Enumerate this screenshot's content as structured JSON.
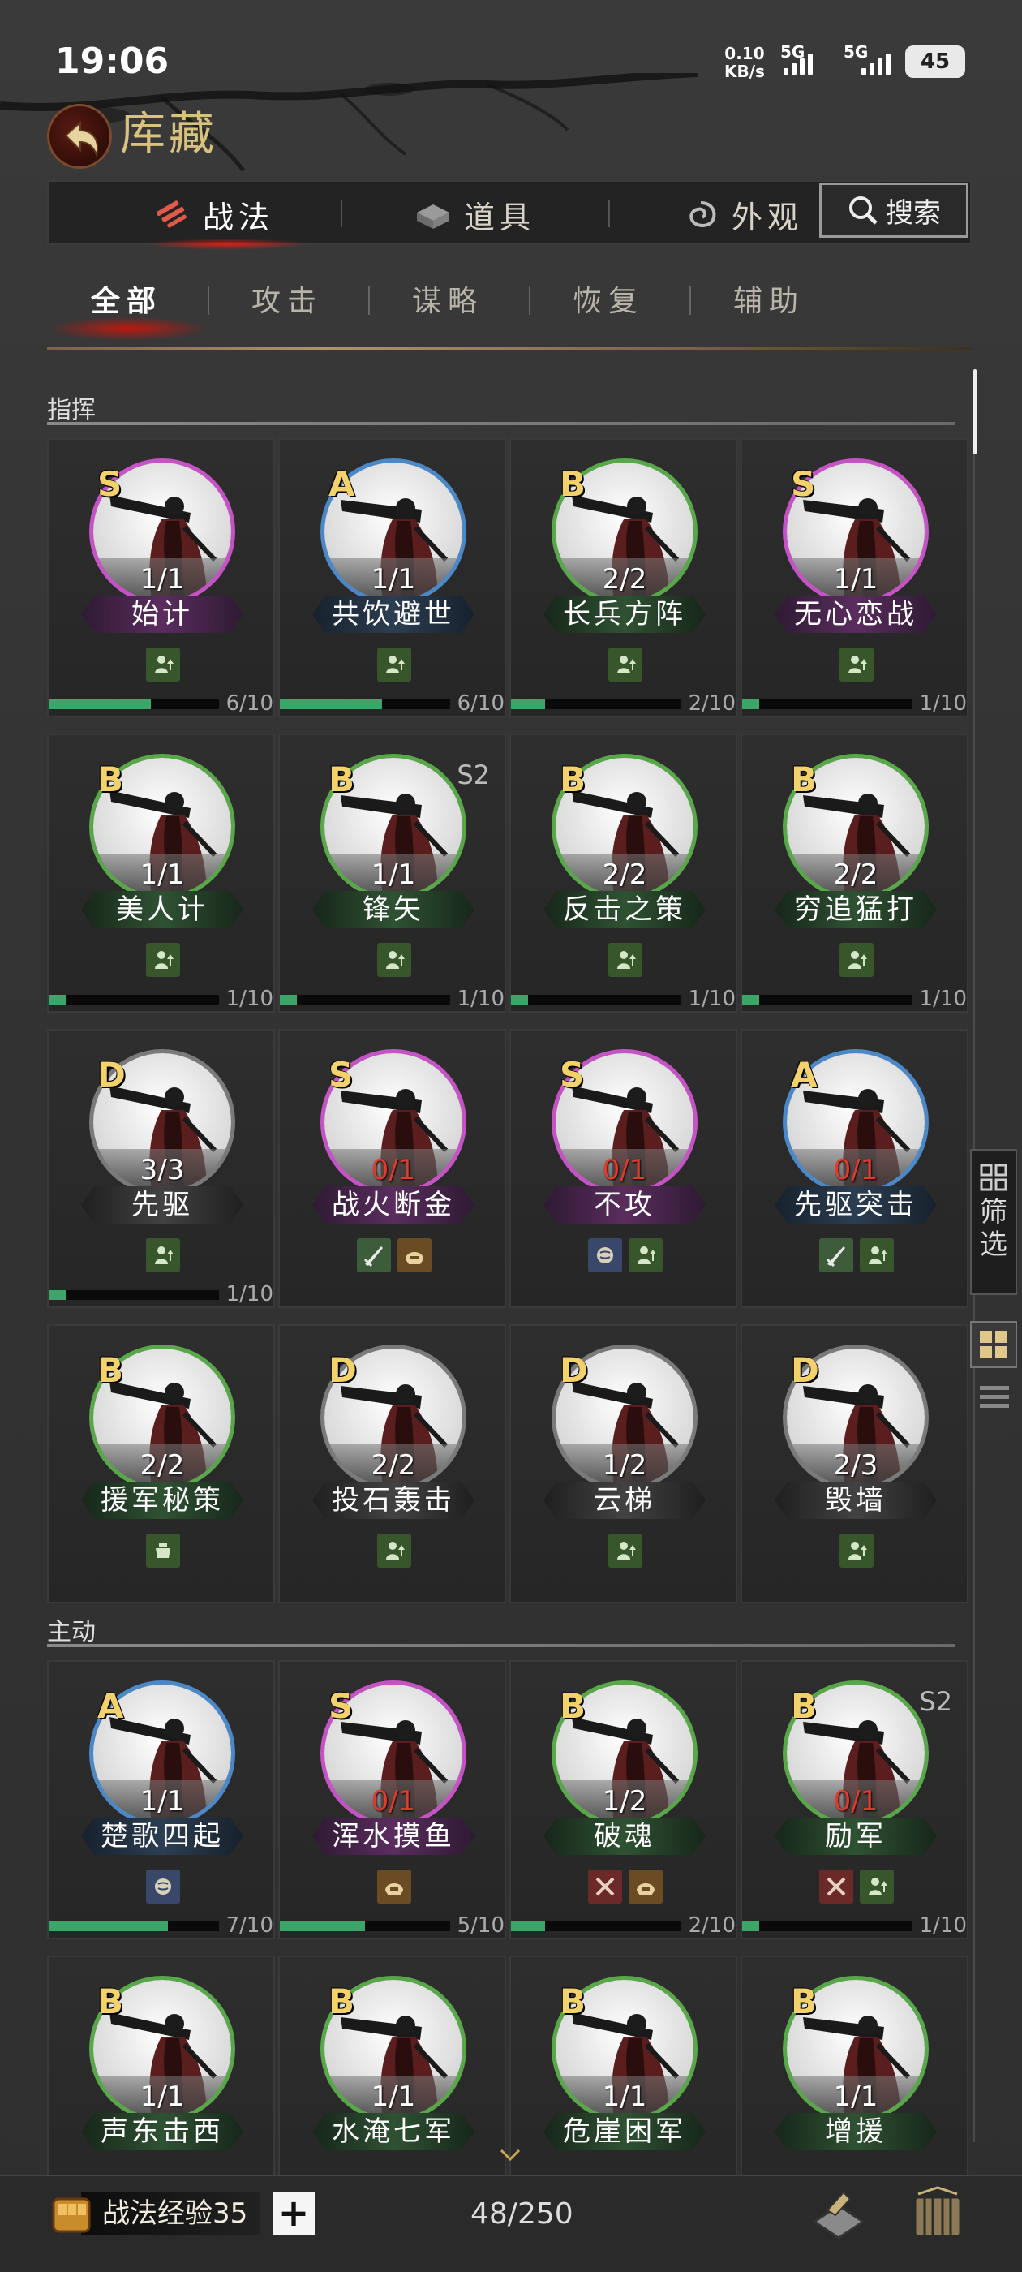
{
  "status_bar": {
    "time": "19:06",
    "net_speed": "0.10",
    "net_unit": "KB/s",
    "sim1": "5G",
    "sim2": "5G",
    "battery": "45"
  },
  "header": {
    "title": "库藏"
  },
  "tabs": [
    {
      "label": "战法",
      "icon": "scroll-icon",
      "active": true
    },
    {
      "label": "道具",
      "icon": "chest-icon",
      "active": false
    },
    {
      "label": "外观",
      "icon": "swirl-icon",
      "active": false
    }
  ],
  "search": {
    "label": "搜索"
  },
  "subtabs": [
    {
      "label": "全部",
      "active": true
    },
    {
      "label": "攻击",
      "active": false
    },
    {
      "label": "谋略",
      "active": false
    },
    {
      "label": "恢复",
      "active": false
    },
    {
      "label": "辅助",
      "active": false
    }
  ],
  "sections": [
    {
      "title": "指挥",
      "rows": [
        [
          {
            "grade": "S",
            "rarity": "purple",
            "count": "1/1",
            "count_red": false,
            "name": "始计",
            "tags": [
              [
                "green",
                "up"
              ]
            ],
            "progress": 0.6,
            "progress_text": "6/10",
            "season": ""
          },
          {
            "grade": "A",
            "rarity": "blue",
            "count": "1/1",
            "count_red": false,
            "name": "共饮避世",
            "tags": [
              [
                "green",
                "up"
              ]
            ],
            "progress": 0.6,
            "progress_text": "6/10",
            "season": ""
          },
          {
            "grade": "B",
            "rarity": "green",
            "count": "2/2",
            "count_red": false,
            "name": "长兵方阵",
            "tags": [
              [
                "green",
                "up"
              ]
            ],
            "progress": 0.2,
            "progress_text": "2/10",
            "season": ""
          },
          {
            "grade": "S",
            "rarity": "purple",
            "count": "1/1",
            "count_red": false,
            "name": "无心恋战",
            "tags": [
              [
                "green",
                "up"
              ]
            ],
            "progress": 0.1,
            "progress_text": "1/10",
            "season": ""
          }
        ],
        [
          {
            "grade": "B",
            "rarity": "green",
            "count": "1/1",
            "count_red": false,
            "name": "美人计",
            "tags": [
              [
                "green",
                "up"
              ]
            ],
            "progress": 0.1,
            "progress_text": "1/10",
            "season": ""
          },
          {
            "grade": "B",
            "rarity": "green",
            "count": "1/1",
            "count_red": false,
            "name": "锋矢",
            "tags": [
              [
                "green",
                "up"
              ]
            ],
            "progress": 0.1,
            "progress_text": "1/10",
            "season": "S2"
          },
          {
            "grade": "B",
            "rarity": "green",
            "count": "2/2",
            "count_red": false,
            "name": "反击之策",
            "tags": [
              [
                "green",
                "up"
              ]
            ],
            "progress": 0.1,
            "progress_text": "1/10",
            "season": ""
          },
          {
            "grade": "B",
            "rarity": "green",
            "count": "2/2",
            "count_red": false,
            "name": "穷追猛打",
            "tags": [
              [
                "green",
                "up"
              ]
            ],
            "progress": 0.1,
            "progress_text": "1/10",
            "season": ""
          }
        ],
        [
          {
            "grade": "D",
            "rarity": "gray",
            "count": "3/3",
            "count_red": false,
            "name": "先驱",
            "tags": [
              [
                "green",
                "up"
              ]
            ],
            "progress": 0.1,
            "progress_text": "1/10",
            "season": ""
          },
          {
            "grade": "S",
            "rarity": "purple",
            "count": "0/1",
            "count_red": true,
            "name": "战火断金",
            "tags": [
              [
                "teal",
                "blade"
              ],
              [
                "brown",
                "helm"
              ]
            ],
            "progress": null,
            "progress_text": "",
            "season": ""
          },
          {
            "grade": "S",
            "rarity": "purple",
            "count": "0/1",
            "count_red": true,
            "name": "不攻",
            "tags": [
              [
                "blue",
                "brain"
              ],
              [
                "green",
                "up"
              ]
            ],
            "progress": null,
            "progress_text": "",
            "season": ""
          },
          {
            "grade": "A",
            "rarity": "blue",
            "count": "0/1",
            "count_red": true,
            "name": "先驱突击",
            "tags": [
              [
                "teal",
                "blade"
              ],
              [
                "green",
                "up"
              ]
            ],
            "progress": null,
            "progress_text": "",
            "season": ""
          }
        ],
        [
          {
            "grade": "B",
            "rarity": "green",
            "count": "2/2",
            "count_red": false,
            "name": "援军秘策",
            "tags": [
              [
                "green",
                "pot"
              ]
            ],
            "progress": null,
            "progress_text": "",
            "season": ""
          },
          {
            "grade": "D",
            "rarity": "gray",
            "count": "2/2",
            "count_red": false,
            "name": "投石轰击",
            "tags": [
              [
                "green",
                "up"
              ]
            ],
            "progress": null,
            "progress_text": "",
            "season": ""
          },
          {
            "grade": "D",
            "rarity": "gray",
            "count": "1/2",
            "count_red": false,
            "name": "云梯",
            "tags": [
              [
                "green",
                "up"
              ]
            ],
            "progress": null,
            "progress_text": "",
            "season": ""
          },
          {
            "grade": "D",
            "rarity": "gray",
            "count": "2/3",
            "count_red": false,
            "name": "毁墙",
            "tags": [
              [
                "green",
                "up"
              ]
            ],
            "progress": null,
            "progress_text": "",
            "season": ""
          }
        ]
      ]
    },
    {
      "title": "主动",
      "rows": [
        [
          {
            "grade": "A",
            "rarity": "blue",
            "count": "1/1",
            "count_red": false,
            "name": "楚歌四起",
            "tags": [
              [
                "blue",
                "brain"
              ]
            ],
            "progress": 0.7,
            "progress_text": "7/10",
            "season": ""
          },
          {
            "grade": "S",
            "rarity": "purple",
            "count": "0/1",
            "count_red": true,
            "name": "浑水摸鱼",
            "tags": [
              [
                "brown",
                "helm"
              ]
            ],
            "progress": 0.5,
            "progress_text": "5/10",
            "season": ""
          },
          {
            "grade": "B",
            "rarity": "green",
            "count": "1/2",
            "count_red": false,
            "name": "破魂",
            "tags": [
              [
                "red",
                "swords"
              ],
              [
                "brown",
                "helm"
              ]
            ],
            "progress": 0.2,
            "progress_text": "2/10",
            "season": ""
          },
          {
            "grade": "B",
            "rarity": "green",
            "count": "0/1",
            "count_red": true,
            "name": "励军",
            "tags": [
              [
                "red",
                "swords"
              ],
              [
                "green",
                "up"
              ]
            ],
            "progress": 0.1,
            "progress_text": "1/10",
            "season": "S2"
          }
        ],
        [
          {
            "grade": "B",
            "rarity": "green",
            "count": "1/1",
            "count_red": false,
            "name": "声东击西",
            "tags": [],
            "progress": null,
            "progress_text": "",
            "season": ""
          },
          {
            "grade": "B",
            "rarity": "green",
            "count": "1/1",
            "count_red": false,
            "name": "水淹七军",
            "tags": [],
            "progress": null,
            "progress_text": "",
            "season": ""
          },
          {
            "grade": "B",
            "rarity": "green",
            "count": "1/1",
            "count_red": false,
            "name": "危崖困军",
            "tags": [],
            "progress": null,
            "progress_text": "",
            "season": ""
          },
          {
            "grade": "B",
            "rarity": "green",
            "count": "1/1",
            "count_red": false,
            "name": "增援",
            "tags": [],
            "progress": null,
            "progress_text": "",
            "season": ""
          }
        ]
      ]
    }
  ],
  "side": {
    "filter_label": "筛选"
  },
  "bottom": {
    "exp_label": "战法经验35",
    "plus": "+",
    "capacity": "48/250"
  }
}
